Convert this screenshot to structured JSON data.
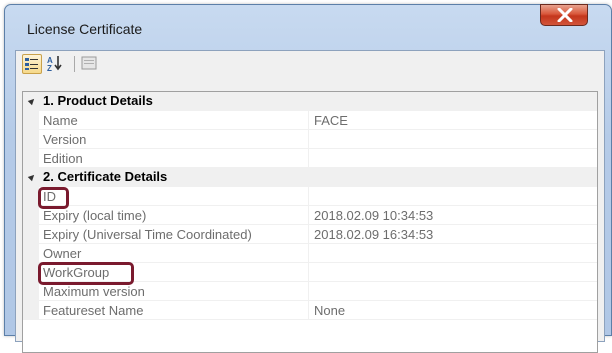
{
  "window": {
    "title": "License Certificate",
    "close_icon": "close-x-icon"
  },
  "toolbar": {
    "buttons": [
      {
        "icon": "categorized-view-icon",
        "active": true
      },
      {
        "icon": "sort-alphabetical-icon",
        "active": false
      },
      {
        "icon": "property-pages-icon",
        "active": false
      }
    ]
  },
  "grid": {
    "categories": [
      {
        "label": "1. Product Details",
        "expanded": true,
        "properties": [
          {
            "name": "Name",
            "value": "FACE"
          },
          {
            "name": "Version",
            "value": ""
          },
          {
            "name": "Edition",
            "value": ""
          }
        ]
      },
      {
        "label": "2. Certificate Details",
        "expanded": true,
        "properties": [
          {
            "name": "ID",
            "value": "",
            "highlighted": true
          },
          {
            "name": "Expiry (local time)",
            "value": "2018.02.09 10:34:53"
          },
          {
            "name": "Expiry (Universal Time Coordinated)",
            "value": "2018.02.09 16:34:53"
          },
          {
            "name": "Owner",
            "value": ""
          },
          {
            "name": "WorkGroup",
            "value": "",
            "highlighted": true
          },
          {
            "name": "Maximum version",
            "value": ""
          },
          {
            "name": "Featureset Name",
            "value": "None"
          }
        ]
      }
    ]
  },
  "colors": {
    "highlight_border": "#7a1a2e",
    "close_button": "#c4361c"
  }
}
